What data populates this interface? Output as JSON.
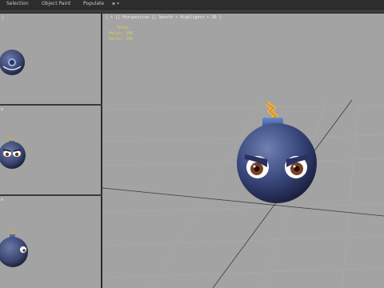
{
  "menu": {
    "items": [
      {
        "label": "Selection"
      },
      {
        "label": "Object Paint"
      },
      {
        "label": "Populate"
      }
    ],
    "dropdown_label": "▪ ▾"
  },
  "viewports": {
    "left": [
      {
        "corner_label": "]"
      },
      {
        "corner_label": "e"
      },
      {
        "corner_label": "e"
      }
    ],
    "perspective": {
      "header_label": "[ + ][ Perspective ][ Smooth + Highlights + 3D ]",
      "stats": {
        "title": "Total",
        "polys_label": "Polys:",
        "polys_value": "200",
        "verts_label": "Verts:",
        "verts_value": "242"
      }
    }
  },
  "colors": {
    "viewport_bg": "#a3a3a3",
    "bomb_body": "#3c4a80",
    "fuse": "#e0a030",
    "cap": "#4a6aa8",
    "stats_text": "#e0d24a"
  },
  "icons": [
    "bomb-model",
    "eye-icon"
  ]
}
